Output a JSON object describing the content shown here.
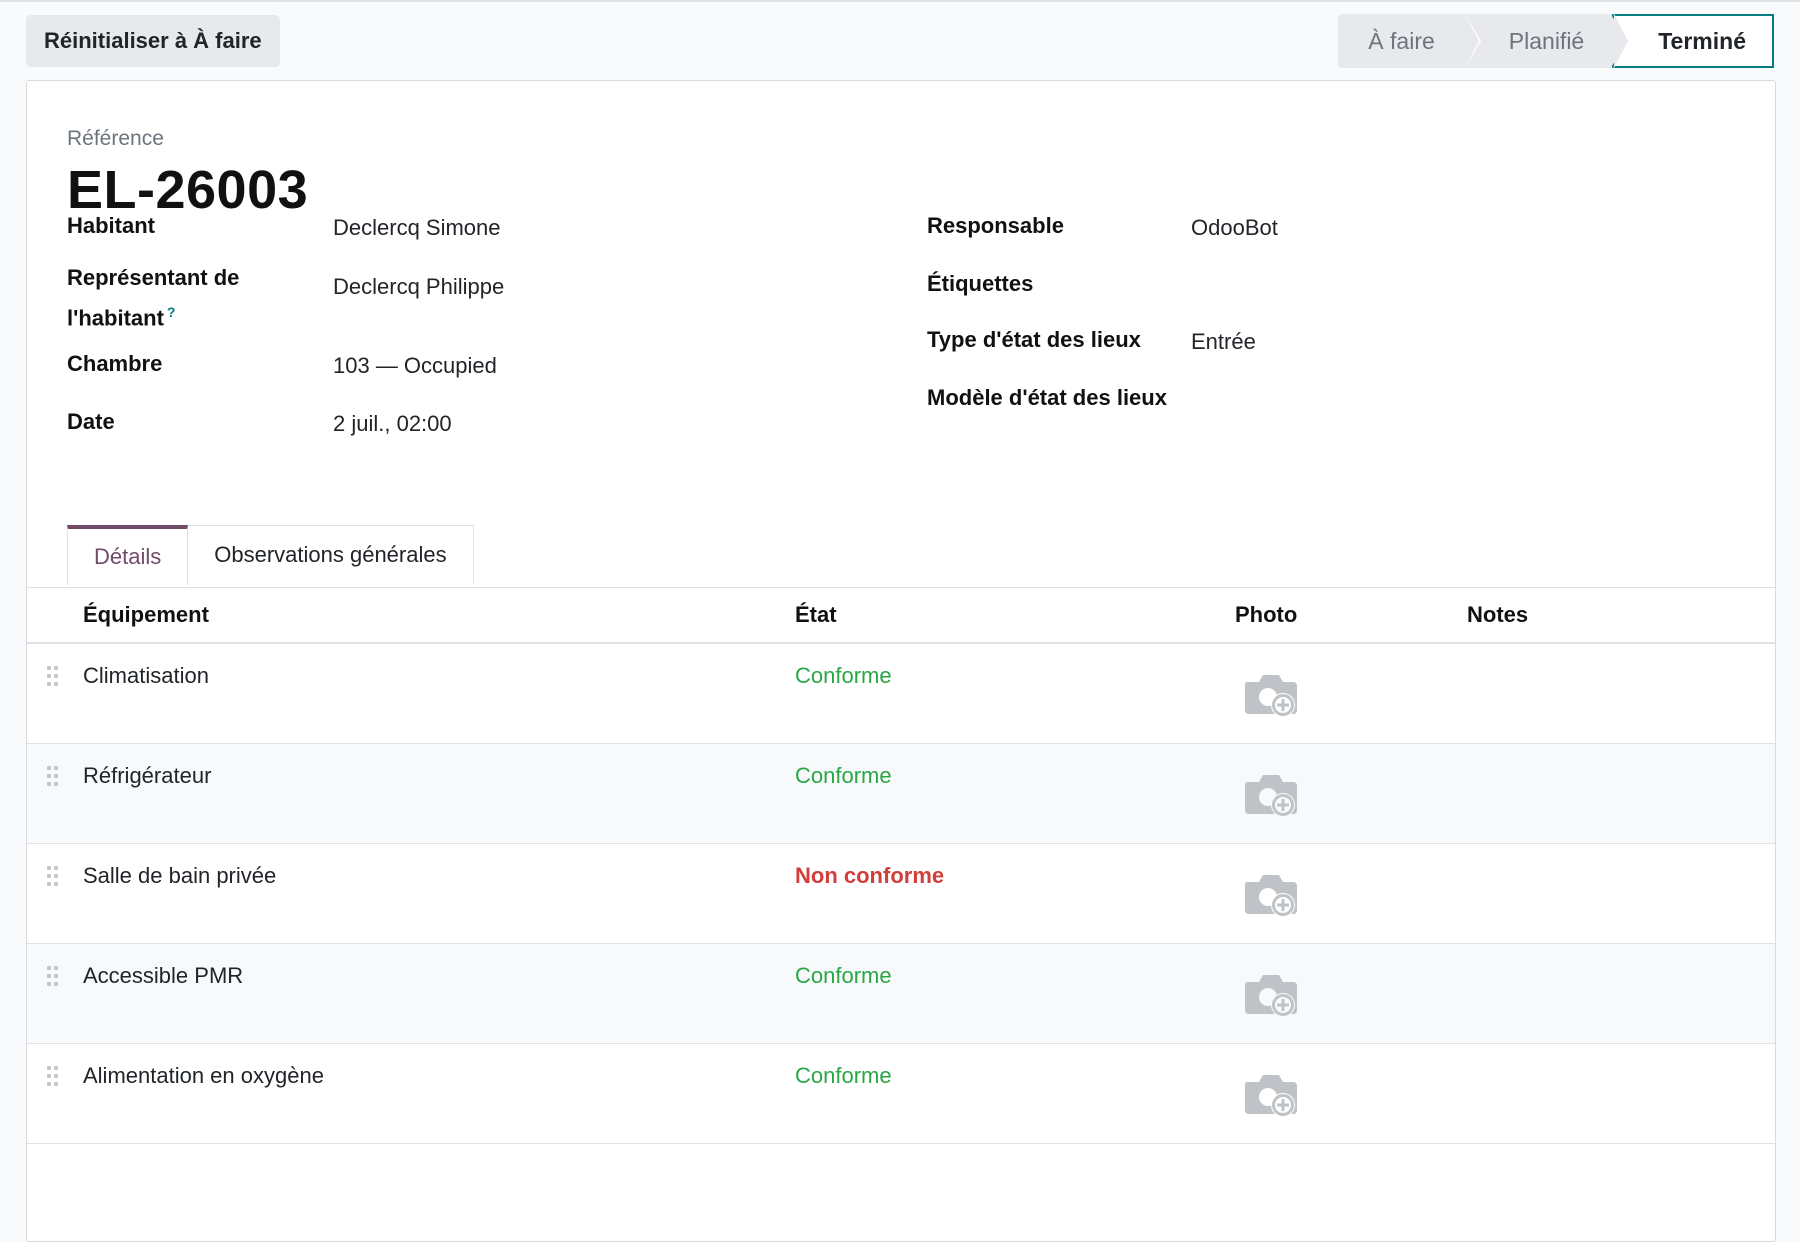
{
  "control": {
    "reset_label": "Réinitialiser à À faire"
  },
  "status": {
    "stages": [
      {
        "label": "À faire"
      },
      {
        "label": "Planifié"
      },
      {
        "label": "Terminé",
        "current": true
      }
    ],
    "accent_color": "#017e84"
  },
  "record": {
    "reference_label": "Référence",
    "reference_value": "EL-26003"
  },
  "fields": {
    "habitant": {
      "label": "Habitant",
      "value": "Declercq Simone"
    },
    "representant": {
      "label_line1": "Représentant de",
      "label_line2": "l'habitant",
      "help": "?",
      "value": "Declercq Philippe"
    },
    "chambre": {
      "label": "Chambre",
      "value": "103 — Occupied"
    },
    "date": {
      "label": "Date",
      "value": "2 juil., 02:00"
    },
    "responsable": {
      "label": "Responsable",
      "value": "OdooBot"
    },
    "etiquettes": {
      "label": "Étiquettes",
      "value": ""
    },
    "type": {
      "label": "Type d'état des lieux",
      "value": "Entrée"
    },
    "modele": {
      "label": "Modèle d'état des lieux",
      "value": ""
    }
  },
  "tabs": [
    {
      "label": "Détails",
      "active": true
    },
    {
      "label": "Observations générales",
      "active": false
    }
  ],
  "table": {
    "headers": {
      "equipement": "Équipement",
      "etat": "État",
      "photo": "Photo",
      "notes": "Notes"
    },
    "rows": [
      {
        "equipement": "Climatisation",
        "etat": "Conforme",
        "status": "ok",
        "photo_icon": "camera-add-icon"
      },
      {
        "equipement": "Réfrigérateur",
        "etat": "Conforme",
        "status": "ok",
        "photo_icon": "camera-add-icon"
      },
      {
        "equipement": "Salle de bain privée",
        "etat": "Non conforme",
        "status": "nok",
        "photo_icon": "camera-add-icon"
      },
      {
        "equipement": "Accessible PMR",
        "etat": "Conforme",
        "status": "ok",
        "photo_icon": "camera-add-icon"
      },
      {
        "equipement": "Alimentation en oxygène",
        "etat": "Conforme",
        "status": "ok",
        "photo_icon": "camera-add-icon"
      }
    ],
    "colors": {
      "ok": "#28a745",
      "nok": "#d23f3a"
    }
  }
}
